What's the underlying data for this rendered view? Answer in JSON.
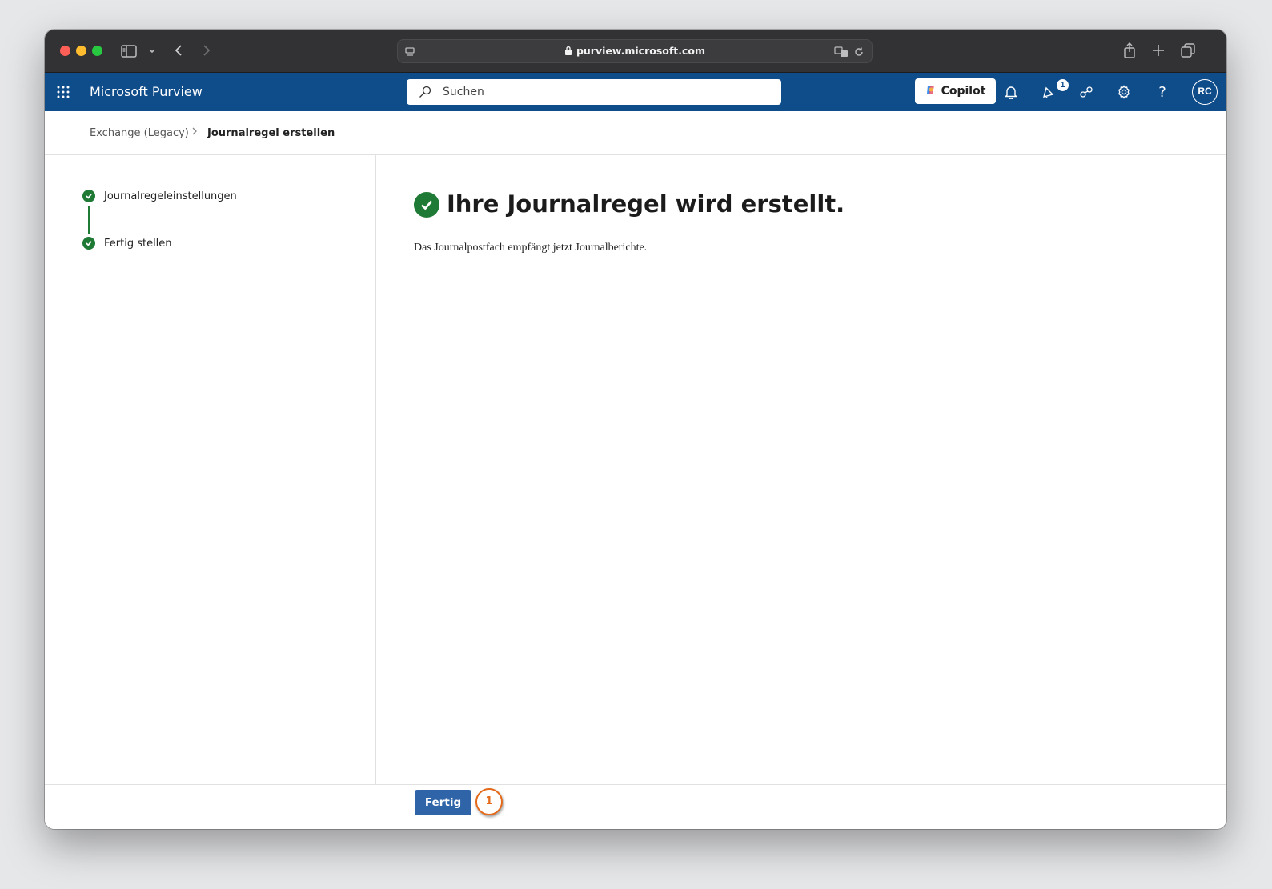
{
  "browser": {
    "url": "purview.microsoft.com"
  },
  "app": {
    "title": "Microsoft Purview",
    "search_placeholder": "Suchen",
    "copilot_label": "Copilot",
    "notification_count": "1",
    "avatar_initials": "RC",
    "brand_color": "#0f4c8a"
  },
  "breadcrumb": {
    "parent": "Exchange (Legacy)",
    "separator": ">",
    "current": "Journalregel erstellen"
  },
  "steps": [
    {
      "label": "Journalregeleinstellungen",
      "status": "complete"
    },
    {
      "label": "Fertig stellen",
      "status": "complete"
    }
  ],
  "main": {
    "headline": "Ihre Journalregel wird erstellt.",
    "description": "Das Journalpostfach empfängt jetzt Journalberichte."
  },
  "footer": {
    "done_label": "Fertig",
    "step_marker": "1"
  }
}
